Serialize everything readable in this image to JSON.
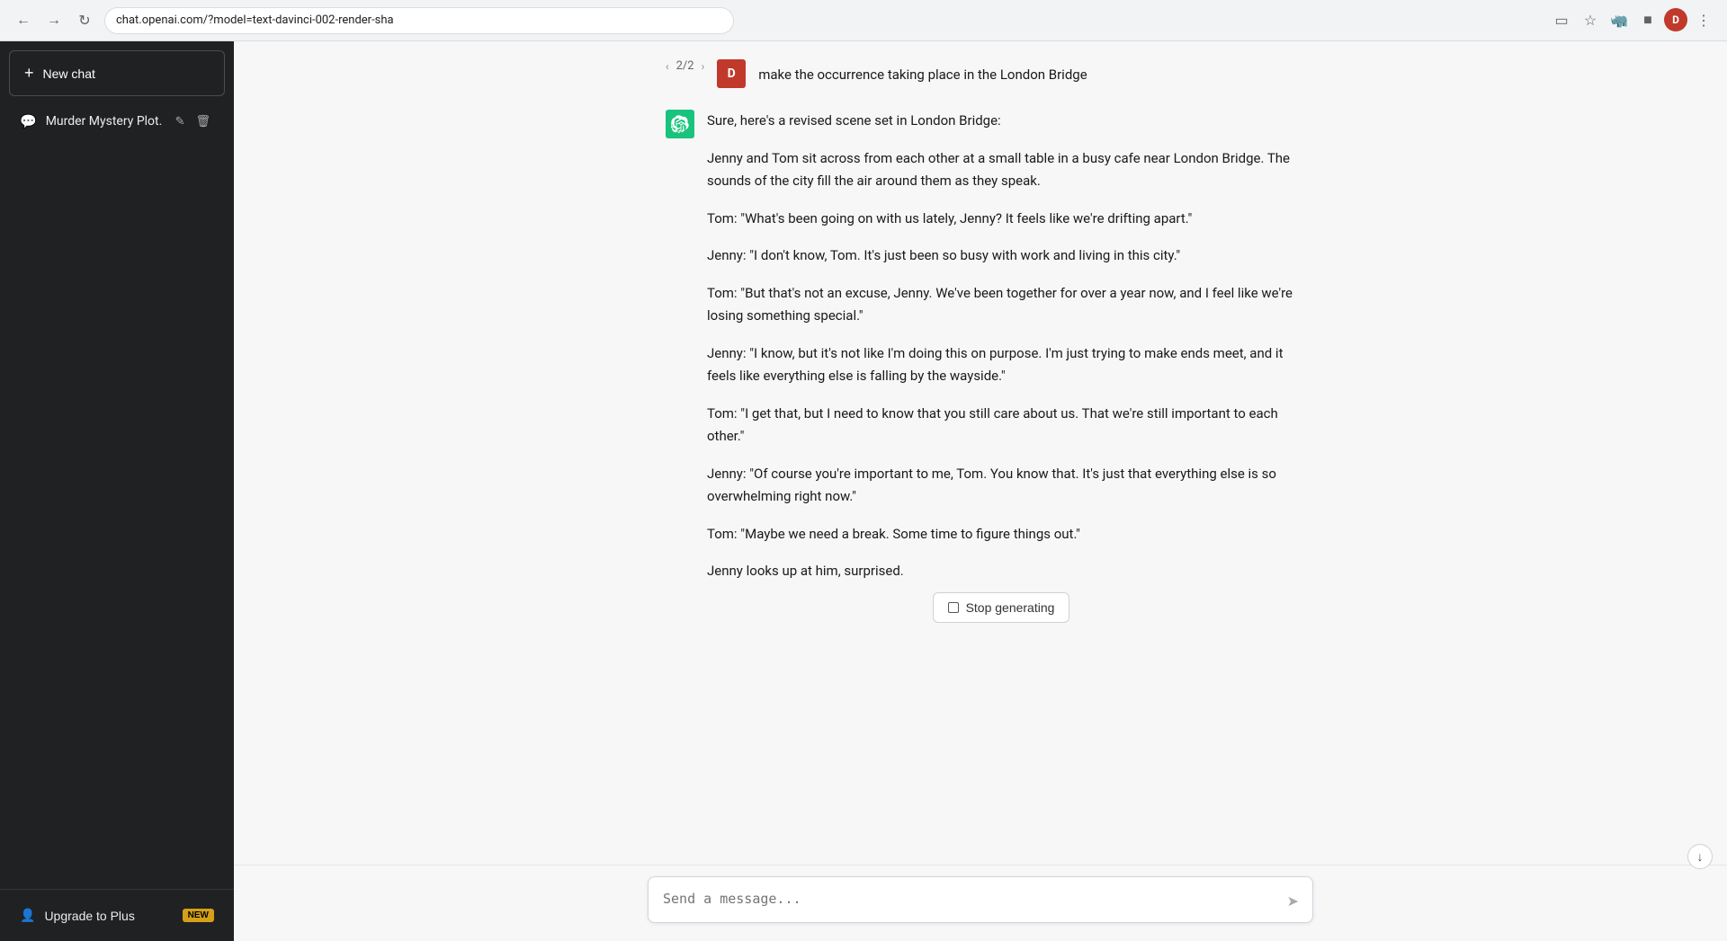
{
  "browser": {
    "url": "chat.openai.com/?model=text-davinci-002-render-sha",
    "profile_initial": "D"
  },
  "sidebar": {
    "new_chat_label": "New chat",
    "chat_items": [
      {
        "label": "Murder Mystery Plot.",
        "id": "murder-mystery"
      }
    ],
    "upgrade_label": "Upgrade to Plus",
    "new_badge": "NEW"
  },
  "chat": {
    "nav": {
      "current": "2",
      "total": "2"
    },
    "user_message": "make the occurrence taking place in the London Bridge",
    "ai_response": {
      "intro": "Sure, here's a revised scene set in London Bridge:",
      "paragraphs": [
        "Jenny and Tom sit across from each other at a small table in a busy cafe near London Bridge. The sounds of the city fill the air around them as they speak.",
        "Tom: \"What's been going on with us lately, Jenny? It feels like we're drifting apart.\"",
        "Jenny: \"I don't know, Tom. It's just been so busy with work and living in this city.\"",
        "Tom: \"But that's not an excuse, Jenny. We've been together for over a year now, and I feel like we're losing something special.\"",
        "Jenny: \"I know, but it's not like I'm doing this on purpose. I'm just trying to make ends meet, and it feels like everything else is falling by the wayside.\"",
        "Tom: \"I get that, but I need to know that you still care about us. That we're still important to each other.\"",
        "Jenny: \"Of course you're important to me, Tom. You know that. It's just that everything else is so overwhelming right now.\"",
        "Tom: \"Maybe we need a break. Some time to figure things out.\"",
        "Jenny looks up at him, surprised."
      ]
    },
    "stop_button_label": "Stop generating",
    "input_placeholder": "Send a message...",
    "scroll_down_char": "↓"
  }
}
